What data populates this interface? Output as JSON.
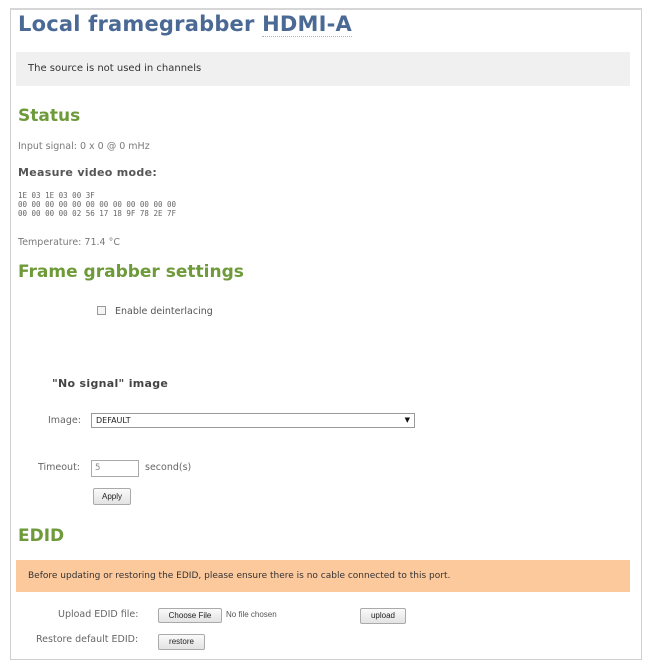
{
  "header": {
    "title_prefix": "Local framegrabber",
    "title_port": "HDMI-A"
  },
  "info_bar": {
    "text": "The source is not used in channels"
  },
  "status": {
    "heading": "Status",
    "input_signal": "Input signal: 0 x 0 @ 0 mHz",
    "measure_heading": "Measure video mode:",
    "hex_lines": [
      "1E 03 1E 03 00 3F",
      "00 00 00 00 00 00 00 00 00 00 00 00",
      "00 00 00 00 02 56 17 18 9F 78 2E 7F"
    ],
    "temperature": "Temperature: 71.4 °C"
  },
  "framegrabber": {
    "heading": "Frame grabber settings",
    "deinterlace_label": "Enable deinterlacing",
    "deinterlace_checked": false,
    "no_signal_heading": "\"No signal\" image",
    "image_label": "Image:",
    "image_value": "DEFAULT",
    "timeout_label": "Timeout:",
    "timeout_value": "5",
    "timeout_unit": "second(s)",
    "apply_label": "Apply"
  },
  "edid": {
    "heading": "EDID",
    "warning": "Before updating or restoring the EDID, please ensure there is no cable connected to this port.",
    "upload_label": "Upload EDID file:",
    "choose_file_label": "Choose File",
    "no_file_text": "No file chosen",
    "upload_button": "upload",
    "restore_label": "Restore default EDID:",
    "restore_button": "restore"
  },
  "colors": {
    "title": "#4a6a95",
    "section_heading": "#6e9a3a",
    "info_bar_bg": "#f0f0f0",
    "warning_bg": "#fcc99d"
  },
  "icons": {
    "select_arrow": "dropdown-arrow-icon",
    "checkbox": "checkbox-icon"
  }
}
